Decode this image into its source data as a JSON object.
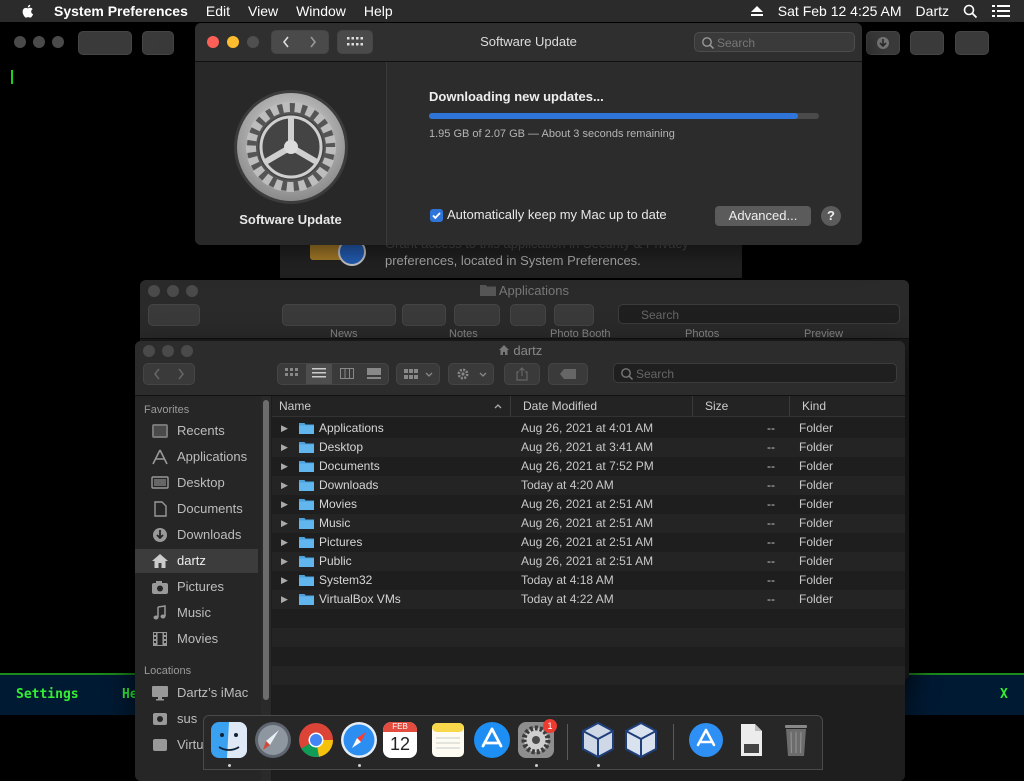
{
  "menubar": {
    "app_name": "System Preferences",
    "menus": [
      "Edit",
      "View",
      "Window",
      "Help"
    ],
    "datetime": "Sat Feb 12  4:25 AM",
    "user": "Dartz"
  },
  "terminal": {
    "settings_label": "Settings",
    "help_fragment": "He",
    "close_label": "X"
  },
  "software_update": {
    "window_title": "Software Update",
    "search_placeholder": "Search",
    "pane_label": "Software Update",
    "status": "Downloading new updates...",
    "progress_fraction": 0.945,
    "progress_detail": "1.95 GB of 2.07 GB — About 3 seconds remaining",
    "auto_update_label": "Automatically keep my Mac up to date",
    "auto_update_checked": true,
    "advanced_button": "Advanced...",
    "help_button": "?",
    "accent_color": "#2e74d9"
  },
  "security_dialog": {
    "line1": "Grant access to this application in Security & Privacy",
    "line2": "preferences, located in System Preferences."
  },
  "applications_window": {
    "title": "Applications",
    "search_placeholder": "Search",
    "visible_items": [
      "News",
      "Notes",
      "Photo Booth",
      "Photos",
      "Preview"
    ]
  },
  "finder": {
    "title": "dartz",
    "search_placeholder": "Search",
    "sidebar": {
      "favorites_heading": "Favorites",
      "favorites": [
        {
          "label": "Recents",
          "icon": "clock-icon"
        },
        {
          "label": "Applications",
          "icon": "applications-icon"
        },
        {
          "label": "Desktop",
          "icon": "desktop-icon"
        },
        {
          "label": "Documents",
          "icon": "documents-icon"
        },
        {
          "label": "Downloads",
          "icon": "downloads-icon"
        },
        {
          "label": "dartz",
          "icon": "home-icon",
          "selected": true
        },
        {
          "label": "Pictures",
          "icon": "camera-icon"
        },
        {
          "label": "Music",
          "icon": "music-note-icon"
        },
        {
          "label": "Movies",
          "icon": "film-icon"
        }
      ],
      "locations_heading": "Locations",
      "locations": [
        {
          "label": "Dartz’s iMac",
          "icon": "imac-icon"
        },
        {
          "label": "sus",
          "icon": "disk-icon"
        },
        {
          "label": "Virtu",
          "icon": "disk-icon"
        }
      ]
    },
    "columns": {
      "name": "Name",
      "date": "Date Modified",
      "size": "Size",
      "kind": "Kind"
    },
    "rows": [
      {
        "name": "Applications",
        "date": "Aug 26, 2021 at 4:01 AM",
        "size": "--",
        "kind": "Folder"
      },
      {
        "name": "Desktop",
        "date": "Aug 26, 2021 at 3:41 AM",
        "size": "--",
        "kind": "Folder"
      },
      {
        "name": "Documents",
        "date": "Aug 26, 2021 at 7:52 PM",
        "size": "--",
        "kind": "Folder"
      },
      {
        "name": "Downloads",
        "date": "Today at 4:20 AM",
        "size": "--",
        "kind": "Folder"
      },
      {
        "name": "Movies",
        "date": "Aug 26, 2021 at 2:51 AM",
        "size": "--",
        "kind": "Folder"
      },
      {
        "name": "Music",
        "date": "Aug 26, 2021 at 2:51 AM",
        "size": "--",
        "kind": "Folder"
      },
      {
        "name": "Pictures",
        "date": "Aug 26, 2021 at 2:51 AM",
        "size": "--",
        "kind": "Folder"
      },
      {
        "name": "Public",
        "date": "Aug 26, 2021 at 2:51 AM",
        "size": "--",
        "kind": "Folder"
      },
      {
        "name": "System32",
        "date": "Today at 4:18 AM",
        "size": "--",
        "kind": "Folder"
      },
      {
        "name": "VirtualBox VMs",
        "date": "Today at 4:22 AM",
        "size": "--",
        "kind": "Folder"
      }
    ]
  },
  "dock": {
    "items": [
      "finder-icon",
      "launchpad-icon",
      "chrome-icon",
      "safari-icon",
      "calendar-icon",
      "notes-icon",
      "app-store-icon",
      "system-preferences-icon",
      "virtualbox-icon",
      "virtualbox-vm-icon",
      "app-store-folder-icon",
      "document-icon",
      "trash-icon"
    ],
    "calendar_month": "FEB",
    "calendar_day": "12",
    "prefs_badge": "1"
  }
}
